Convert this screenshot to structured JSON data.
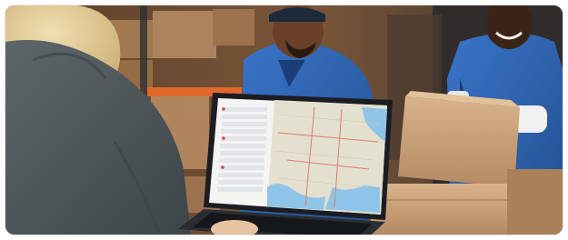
{
  "image": {
    "alt": "",
    "subject": "",
    "screen_ui": {
      "sidebar_rows": 12,
      "map_colors": {
        "land": "#e4e0cf",
        "water": "#8ec4e8",
        "roads": "#e57a6a"
      }
    },
    "palette": {
      "shirt_blue": "#2d63b8",
      "box_tan": "#c9a27a",
      "shelf_orange": "#e0672d",
      "jacket_gray": "#4d5558"
    }
  }
}
